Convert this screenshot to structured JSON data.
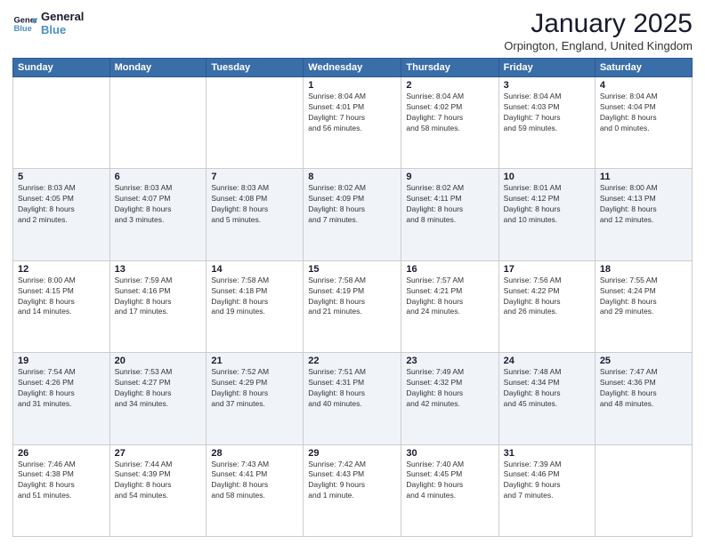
{
  "logo": {
    "line1": "General",
    "line2": "Blue"
  },
  "title": "January 2025",
  "subtitle": "Orpington, England, United Kingdom",
  "weekdays": [
    "Sunday",
    "Monday",
    "Tuesday",
    "Wednesday",
    "Thursday",
    "Friday",
    "Saturday"
  ],
  "weeks": [
    [
      {
        "day": "",
        "detail": ""
      },
      {
        "day": "",
        "detail": ""
      },
      {
        "day": "",
        "detail": ""
      },
      {
        "day": "1",
        "detail": "Sunrise: 8:04 AM\nSunset: 4:01 PM\nDaylight: 7 hours\nand 56 minutes."
      },
      {
        "day": "2",
        "detail": "Sunrise: 8:04 AM\nSunset: 4:02 PM\nDaylight: 7 hours\nand 58 minutes."
      },
      {
        "day": "3",
        "detail": "Sunrise: 8:04 AM\nSunset: 4:03 PM\nDaylight: 7 hours\nand 59 minutes."
      },
      {
        "day": "4",
        "detail": "Sunrise: 8:04 AM\nSunset: 4:04 PM\nDaylight: 8 hours\nand 0 minutes."
      }
    ],
    [
      {
        "day": "5",
        "detail": "Sunrise: 8:03 AM\nSunset: 4:05 PM\nDaylight: 8 hours\nand 2 minutes."
      },
      {
        "day": "6",
        "detail": "Sunrise: 8:03 AM\nSunset: 4:07 PM\nDaylight: 8 hours\nand 3 minutes."
      },
      {
        "day": "7",
        "detail": "Sunrise: 8:03 AM\nSunset: 4:08 PM\nDaylight: 8 hours\nand 5 minutes."
      },
      {
        "day": "8",
        "detail": "Sunrise: 8:02 AM\nSunset: 4:09 PM\nDaylight: 8 hours\nand 7 minutes."
      },
      {
        "day": "9",
        "detail": "Sunrise: 8:02 AM\nSunset: 4:11 PM\nDaylight: 8 hours\nand 8 minutes."
      },
      {
        "day": "10",
        "detail": "Sunrise: 8:01 AM\nSunset: 4:12 PM\nDaylight: 8 hours\nand 10 minutes."
      },
      {
        "day": "11",
        "detail": "Sunrise: 8:00 AM\nSunset: 4:13 PM\nDaylight: 8 hours\nand 12 minutes."
      }
    ],
    [
      {
        "day": "12",
        "detail": "Sunrise: 8:00 AM\nSunset: 4:15 PM\nDaylight: 8 hours\nand 14 minutes."
      },
      {
        "day": "13",
        "detail": "Sunrise: 7:59 AM\nSunset: 4:16 PM\nDaylight: 8 hours\nand 17 minutes."
      },
      {
        "day": "14",
        "detail": "Sunrise: 7:58 AM\nSunset: 4:18 PM\nDaylight: 8 hours\nand 19 minutes."
      },
      {
        "day": "15",
        "detail": "Sunrise: 7:58 AM\nSunset: 4:19 PM\nDaylight: 8 hours\nand 21 minutes."
      },
      {
        "day": "16",
        "detail": "Sunrise: 7:57 AM\nSunset: 4:21 PM\nDaylight: 8 hours\nand 24 minutes."
      },
      {
        "day": "17",
        "detail": "Sunrise: 7:56 AM\nSunset: 4:22 PM\nDaylight: 8 hours\nand 26 minutes."
      },
      {
        "day": "18",
        "detail": "Sunrise: 7:55 AM\nSunset: 4:24 PM\nDaylight: 8 hours\nand 29 minutes."
      }
    ],
    [
      {
        "day": "19",
        "detail": "Sunrise: 7:54 AM\nSunset: 4:26 PM\nDaylight: 8 hours\nand 31 minutes."
      },
      {
        "day": "20",
        "detail": "Sunrise: 7:53 AM\nSunset: 4:27 PM\nDaylight: 8 hours\nand 34 minutes."
      },
      {
        "day": "21",
        "detail": "Sunrise: 7:52 AM\nSunset: 4:29 PM\nDaylight: 8 hours\nand 37 minutes."
      },
      {
        "day": "22",
        "detail": "Sunrise: 7:51 AM\nSunset: 4:31 PM\nDaylight: 8 hours\nand 40 minutes."
      },
      {
        "day": "23",
        "detail": "Sunrise: 7:49 AM\nSunset: 4:32 PM\nDaylight: 8 hours\nand 42 minutes."
      },
      {
        "day": "24",
        "detail": "Sunrise: 7:48 AM\nSunset: 4:34 PM\nDaylight: 8 hours\nand 45 minutes."
      },
      {
        "day": "25",
        "detail": "Sunrise: 7:47 AM\nSunset: 4:36 PM\nDaylight: 8 hours\nand 48 minutes."
      }
    ],
    [
      {
        "day": "26",
        "detail": "Sunrise: 7:46 AM\nSunset: 4:38 PM\nDaylight: 8 hours\nand 51 minutes."
      },
      {
        "day": "27",
        "detail": "Sunrise: 7:44 AM\nSunset: 4:39 PM\nDaylight: 8 hours\nand 54 minutes."
      },
      {
        "day": "28",
        "detail": "Sunrise: 7:43 AM\nSunset: 4:41 PM\nDaylight: 8 hours\nand 58 minutes."
      },
      {
        "day": "29",
        "detail": "Sunrise: 7:42 AM\nSunset: 4:43 PM\nDaylight: 9 hours\nand 1 minute."
      },
      {
        "day": "30",
        "detail": "Sunrise: 7:40 AM\nSunset: 4:45 PM\nDaylight: 9 hours\nand 4 minutes."
      },
      {
        "day": "31",
        "detail": "Sunrise: 7:39 AM\nSunset: 4:46 PM\nDaylight: 9 hours\nand 7 minutes."
      },
      {
        "day": "",
        "detail": ""
      }
    ]
  ]
}
